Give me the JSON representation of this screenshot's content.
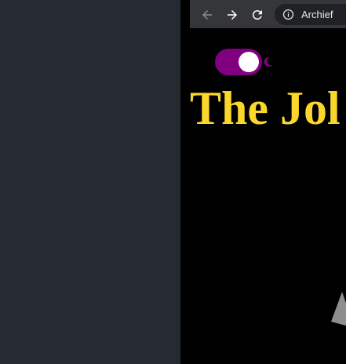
{
  "browser": {
    "address_label": "Archief"
  },
  "page": {
    "title": "The Jol"
  },
  "colors": {
    "toggle": "#800080",
    "title": "#fcd72b",
    "background": "#000000",
    "side_panel": "#262a31"
  },
  "icons": {
    "back": "arrow-left-icon",
    "forward": "arrow-right-icon",
    "reload": "reload-icon",
    "info": "info-icon",
    "theme": "moon-icon"
  }
}
